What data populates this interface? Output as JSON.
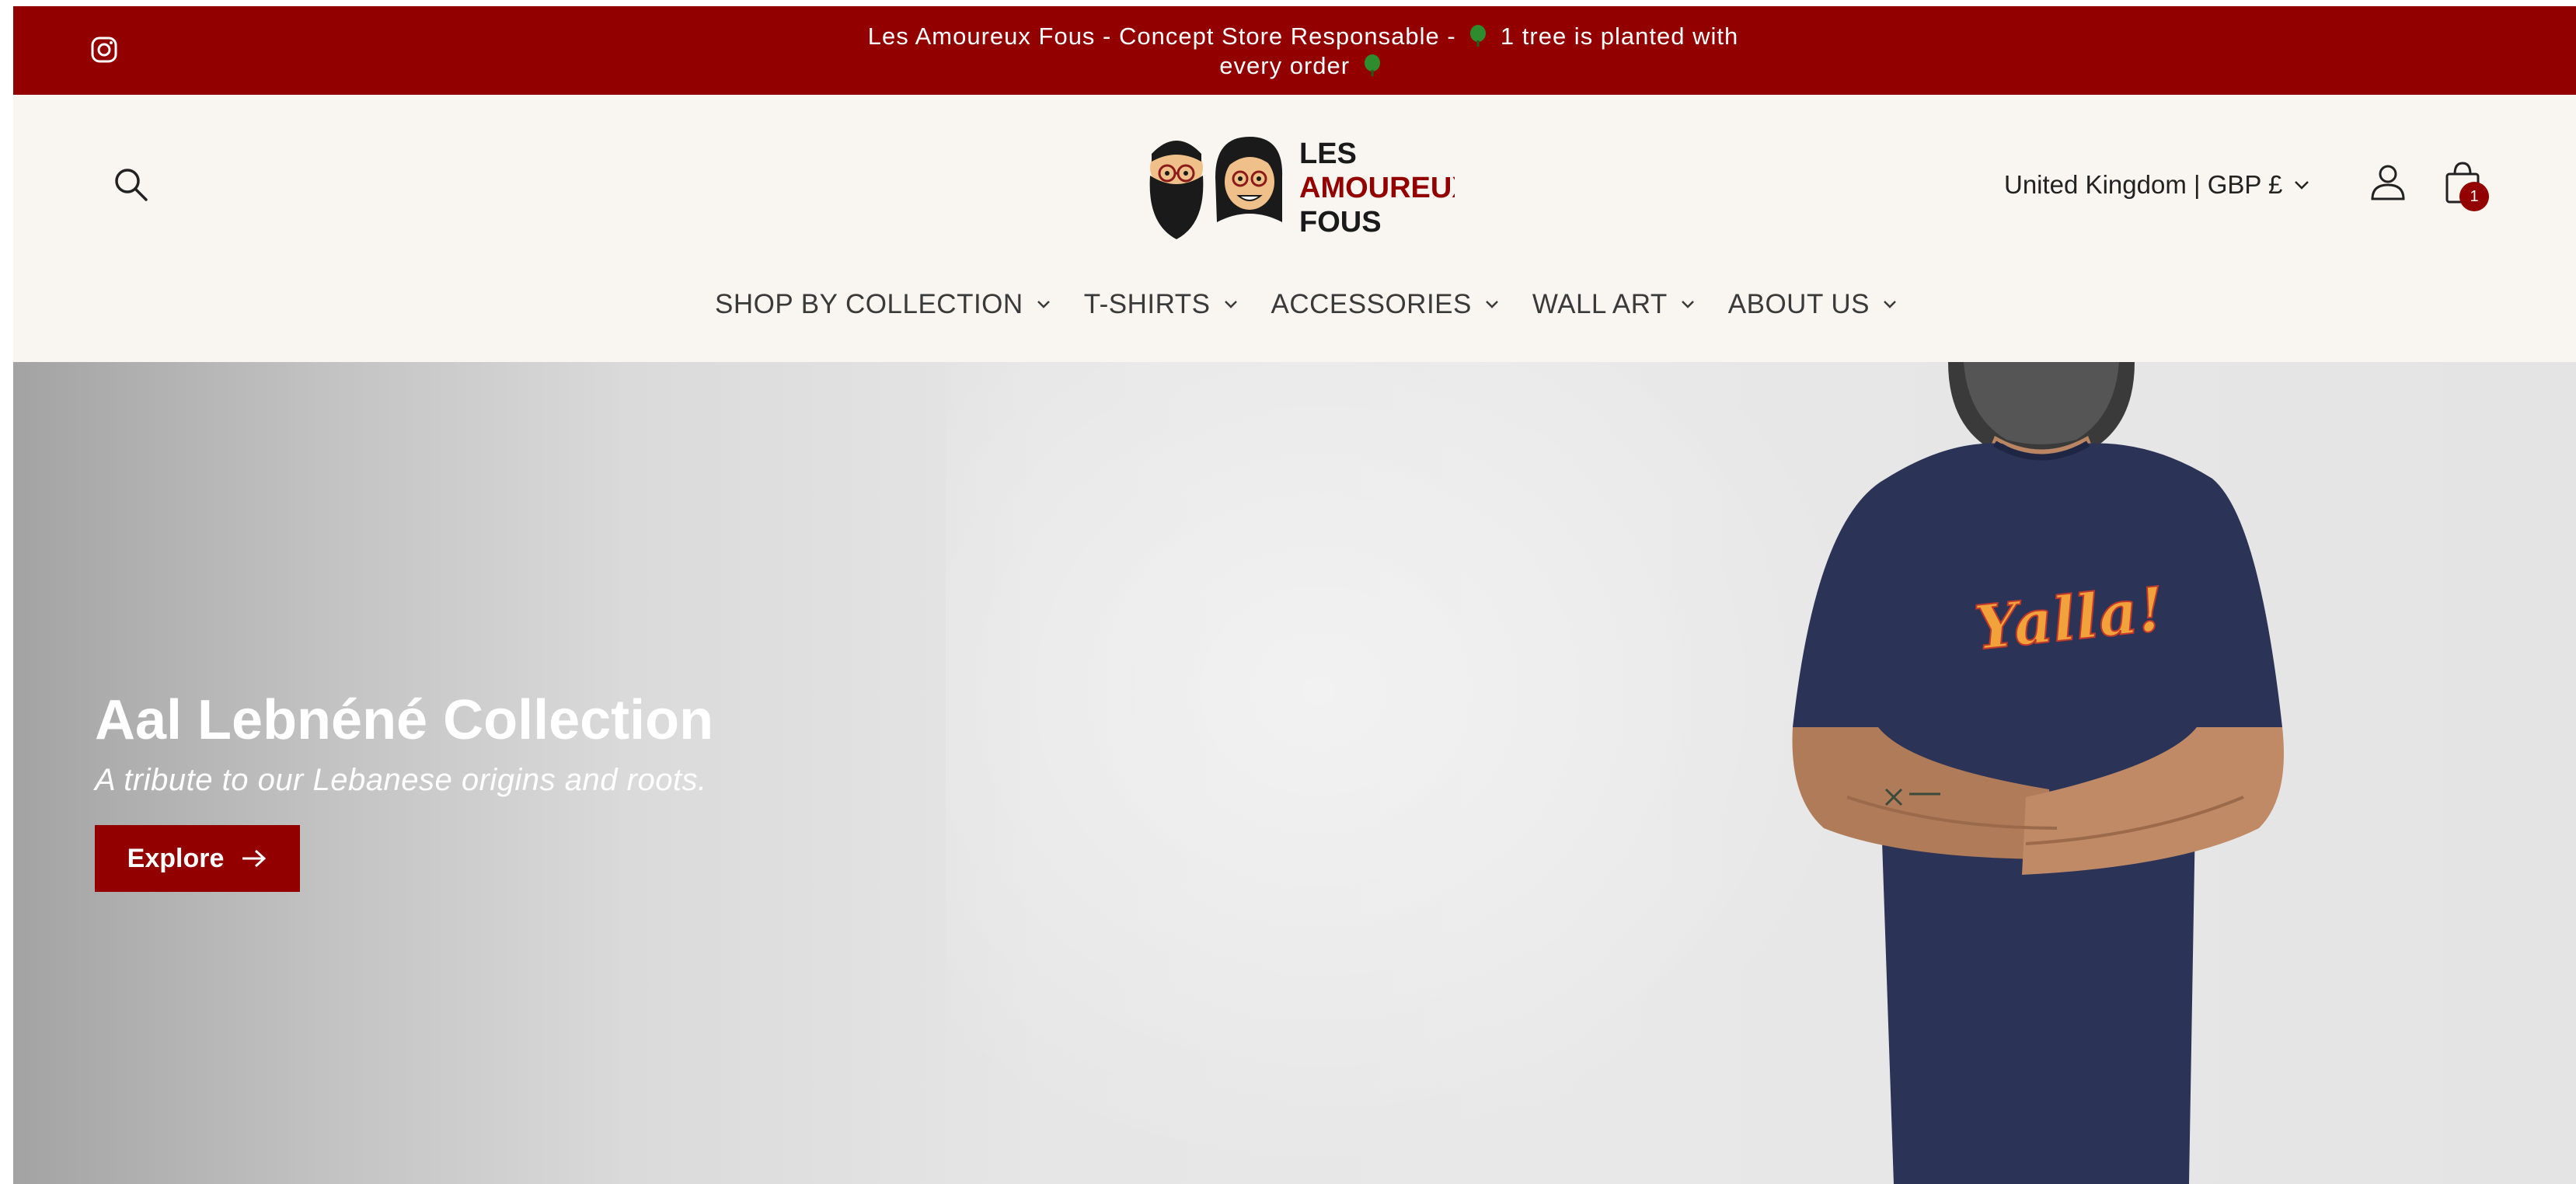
{
  "announcement": {
    "line1": "Les Amoureux Fous - Concept Store Responsable -",
    "line1_after": "1 tree is planted with",
    "line2": "every order",
    "icon": "tree-icon"
  },
  "social": {
    "icon": "instagram-icon"
  },
  "header": {
    "logo": {
      "line1": "LES",
      "line2": "AMOUREUX",
      "line3": "FOUS"
    },
    "region_label": "United Kingdom | GBP £",
    "cart_count": "1"
  },
  "nav": {
    "items": [
      {
        "label": "SHOP BY COLLECTION"
      },
      {
        "label": "T-SHIRTS"
      },
      {
        "label": "ACCESSORIES"
      },
      {
        "label": "WALL ART"
      },
      {
        "label": "ABOUT US"
      }
    ]
  },
  "hero": {
    "title": "Aal Lebnéné Collection",
    "subtitle": "A tribute to our Lebanese origins and roots.",
    "button_label": "Explore",
    "tshirt_print": "Yalla!"
  },
  "colors": {
    "brand_red": "#930000",
    "header_bg": "#f9f5f1",
    "tree_green": "#2e8b2e",
    "shirt_navy": "#2b3356"
  }
}
